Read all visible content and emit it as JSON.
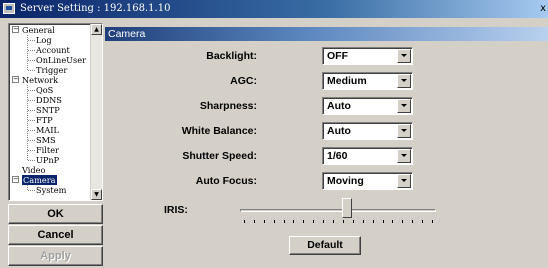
{
  "window": {
    "title": "Server Setting : 192.168.1.10",
    "close_glyph": "x"
  },
  "tree": {
    "items": [
      {
        "label": "General",
        "level": 0,
        "expander": "−"
      },
      {
        "label": "Log",
        "level": 1
      },
      {
        "label": "Account",
        "level": 1
      },
      {
        "label": "OnLineUser",
        "level": 1
      },
      {
        "label": "Trigger",
        "level": 1
      },
      {
        "label": "Network",
        "level": 0,
        "expander": "−"
      },
      {
        "label": "QoS",
        "level": 1
      },
      {
        "label": "DDNS",
        "level": 1
      },
      {
        "label": "SNTP",
        "level": 1
      },
      {
        "label": "FTP",
        "level": 1
      },
      {
        "label": "MAIL",
        "level": 1
      },
      {
        "label": "SMS",
        "level": 1
      },
      {
        "label": "Filter",
        "level": 1
      },
      {
        "label": "UPnP",
        "level": 1
      },
      {
        "label": "Video",
        "level": 0
      },
      {
        "label": "Camera",
        "level": 0,
        "expander": "−",
        "selected": true
      },
      {
        "label": "System",
        "level": 1
      }
    ]
  },
  "buttons": {
    "ok": "OK",
    "cancel": "Cancel",
    "apply": "Apply",
    "default": "Default"
  },
  "panel": {
    "title": "Camera",
    "fields": [
      {
        "label": "Backlight:",
        "value": "OFF"
      },
      {
        "label": "AGC:",
        "value": "Medium"
      },
      {
        "label": "Sharpness:",
        "value": "Auto"
      },
      {
        "label": "White Balance:",
        "value": "Auto"
      },
      {
        "label": "Shutter Speed:",
        "value": "1/60"
      },
      {
        "label": "Auto Focus:",
        "value": "Moving"
      }
    ],
    "iris": {
      "label": "IRIS:",
      "level": 0.55,
      "tick_count": 20
    }
  },
  "colors": {
    "selection": "#0a246a",
    "panel_header_start": "#1f3f7a",
    "face": "#d4d0c8"
  }
}
